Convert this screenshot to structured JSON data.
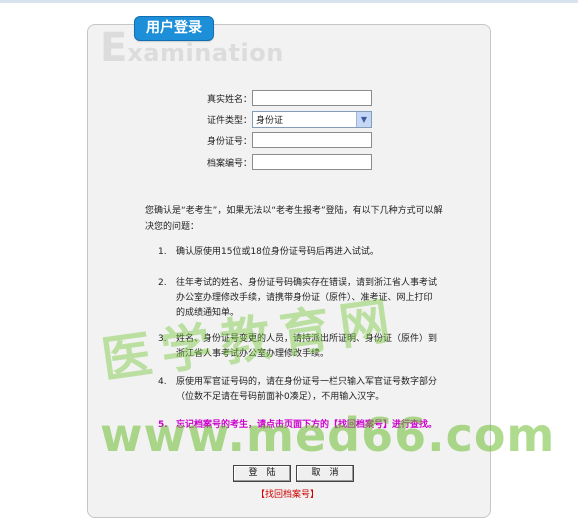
{
  "header": {
    "badge_label": "用户登录",
    "watermark_first_letter": "E",
    "watermark_rest": "xamination"
  },
  "form": {
    "name_label": "真实姓名：",
    "name_value": "",
    "cert_type_label": "证件类型：",
    "cert_type_value": "身份证",
    "id_label": "身份证号：",
    "id_value": "",
    "archive_label": "档案编号：",
    "archive_value": ""
  },
  "intro": "您确认是“老考生”，如果无法以“老考生报考”登陆，有以下几种方式可以解决您的问题：",
  "notes": [
    {
      "num": "1.",
      "text": "确认原使用15位或18位身份证号码后再进入试试。"
    },
    {
      "num": "2.",
      "text": "往年考试的姓名、身份证号码确实存在错误，请到浙江省人事考试办公室办理修改手续，请携带身份证（原件）、准考证、网上打印的成绩通知单。"
    },
    {
      "num": "3.",
      "text": "姓名、身份证号变更的人员，请持派出所证明、身份证（原件）到浙江省人事考试办公室办理修改手续。"
    },
    {
      "num": "4.",
      "text": "原使用军官证号码的，请在身份证号一栏只输入军官证号数字部分（位数不足请在号码前面补0凑足），不用输入汉字。"
    },
    {
      "num": "5.",
      "text": "忘记档案号的考生，请点击页面下方的【找回档案号】进行查找。"
    }
  ],
  "buttons": {
    "login": "登　陆",
    "cancel": "取　消"
  },
  "retrieve_link": "【找回档案号】",
  "watermarks": {
    "cn": "医学教育网",
    "url": "www.med66.com"
  }
}
